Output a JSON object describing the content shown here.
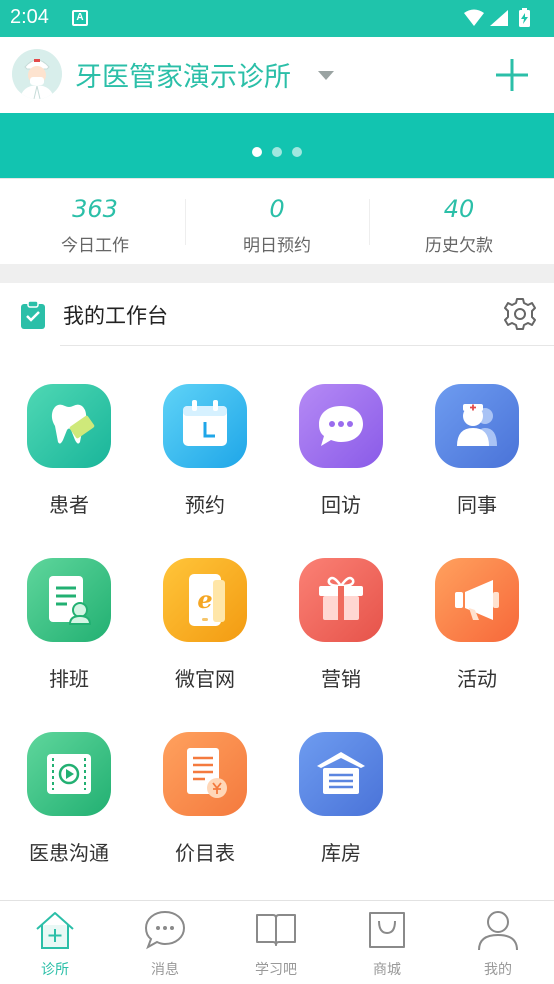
{
  "status_bar": {
    "time": "2:04",
    "notification_badge": "A"
  },
  "header": {
    "clinic_name": "牙医管家演示诊所"
  },
  "banner": {
    "slides": 3,
    "active_slide": 1
  },
  "stats": [
    {
      "value": "363",
      "label": "今日工作"
    },
    {
      "value": "0",
      "label": "明日预约"
    },
    {
      "value": "40",
      "label": "历史欠款"
    }
  ],
  "workbench": {
    "title": "我的工作台",
    "items": [
      {
        "label": "患者",
        "icon": "tooth-icon",
        "color_from": "#4fd8b4",
        "color_to": "#19b59a"
      },
      {
        "label": "预约",
        "icon": "calendar-icon",
        "color_from": "#5fd3f7",
        "color_to": "#1fa6e8"
      },
      {
        "label": "回访",
        "icon": "chat-icon",
        "color_from": "#b58af5",
        "color_to": "#8a5be8"
      },
      {
        "label": "同事",
        "icon": "doctor-icon",
        "color_from": "#6e9cf0",
        "color_to": "#4a73d8"
      },
      {
        "label": "排班",
        "icon": "schedule-icon",
        "color_from": "#5fd69c",
        "color_to": "#22b072"
      },
      {
        "label": "微官网",
        "icon": "web-icon",
        "color_from": "#ffc53a",
        "color_to": "#f39b12"
      },
      {
        "label": "营销",
        "icon": "gift-icon",
        "color_from": "#fb8175",
        "color_to": "#e6534a"
      },
      {
        "label": "活动",
        "icon": "megaphone-icon",
        "color_from": "#ffa15e",
        "color_to": "#f7683a"
      },
      {
        "label": "医患沟通",
        "icon": "video-icon",
        "color_from": "#5fd69c",
        "color_to": "#22b072"
      },
      {
        "label": "价目表",
        "icon": "price-list-icon",
        "color_from": "#ffa15e",
        "color_to": "#f47a3e"
      },
      {
        "label": "库房",
        "icon": "warehouse-icon",
        "color_from": "#6e9cf0",
        "color_to": "#4a73d8"
      }
    ]
  },
  "bottom_nav": [
    {
      "label": "诊所",
      "icon": "clinic-icon",
      "active": true
    },
    {
      "label": "消息",
      "icon": "message-icon",
      "active": false
    },
    {
      "label": "学习吧",
      "icon": "book-icon",
      "active": false
    },
    {
      "label": "商城",
      "icon": "shop-bag-icon",
      "active": false
    },
    {
      "label": "我的",
      "icon": "profile-icon",
      "active": false
    }
  ],
  "colors": {
    "accent": "#2bbfa8",
    "banner": "#12c4b0",
    "status_bar": "#1fc4ab"
  }
}
